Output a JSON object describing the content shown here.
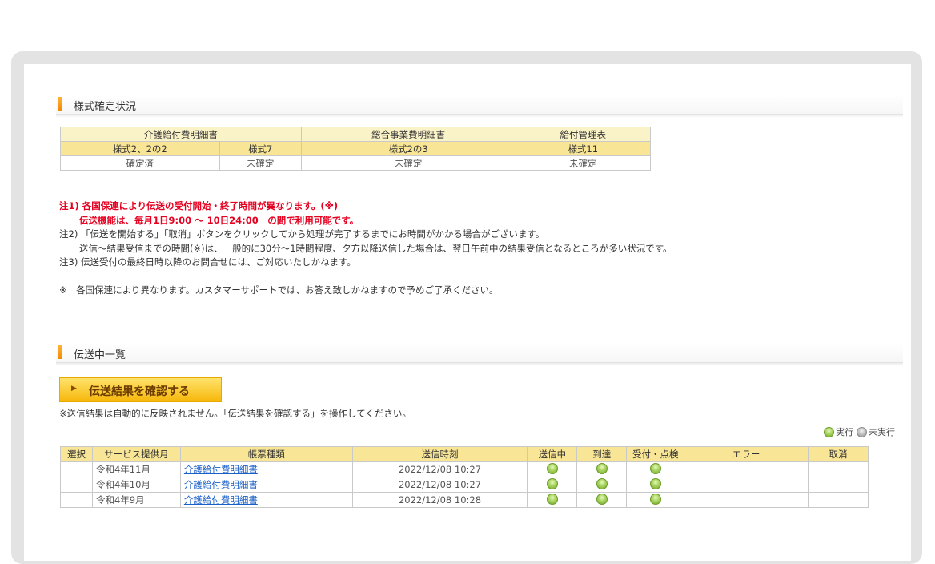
{
  "status_section": {
    "title": "様式確定状況",
    "groups": [
      "介護給付費明細書",
      "総合事業費明細書",
      "給付管理表"
    ],
    "forms": [
      "様式2、2の2",
      "様式7",
      "様式2の3",
      "様式11"
    ],
    "statuses": [
      "確定済",
      "未確定",
      "未確定",
      "未確定"
    ]
  },
  "notes": {
    "n1_line1": "注1) 各国保連により伝送の受付開始・終了時間が異なります。(※)",
    "n1_line2": "伝送機能は、毎月1日9:00 〜 10日24:00　の間で利用可能です。",
    "n2_line1": "注2) 「伝送を開始する」「取消」ボタンをクリックしてから処理が完了するまでにお時間がかかる場合がございます。",
    "n2_line2": "送信〜結果受信までの時間(※)は、一般的に30分〜1時間程度、夕方以降送信した場合は、翌日午前中の結果受信となるところが多い状況です。",
    "n3": "注3) 伝送受付の最終日時以降のお問合せには、ご対応いたしかねます。",
    "footnote": "※　各国保連により異なります。カスタマーサポートでは、お答え致しかねますので予めご了承ください。"
  },
  "transfer_section": {
    "title": "伝送中一覧",
    "button_label": "伝送結果を確認する",
    "info": "※送信結果は自動的に反映されません。「伝送結果を確認する」を操作してください。",
    "legend_done": "実行",
    "legend_pending": "未実行",
    "columns": [
      "選択",
      "サービス提供月",
      "帳票種類",
      "送信時刻",
      "送信中",
      "到達",
      "受付・点検",
      "エラー",
      "取消"
    ],
    "rows": [
      {
        "month": "令和4年11月",
        "form": "介護給付費明細書",
        "time": "2022/12/08 10:27"
      },
      {
        "month": "令和4年10月",
        "form": "介護給付費明細書",
        "time": "2022/12/08 10:27"
      },
      {
        "month": "令和4年9月",
        "form": "介護給付費明細書",
        "time": "2022/12/08 10:28"
      }
    ]
  }
}
